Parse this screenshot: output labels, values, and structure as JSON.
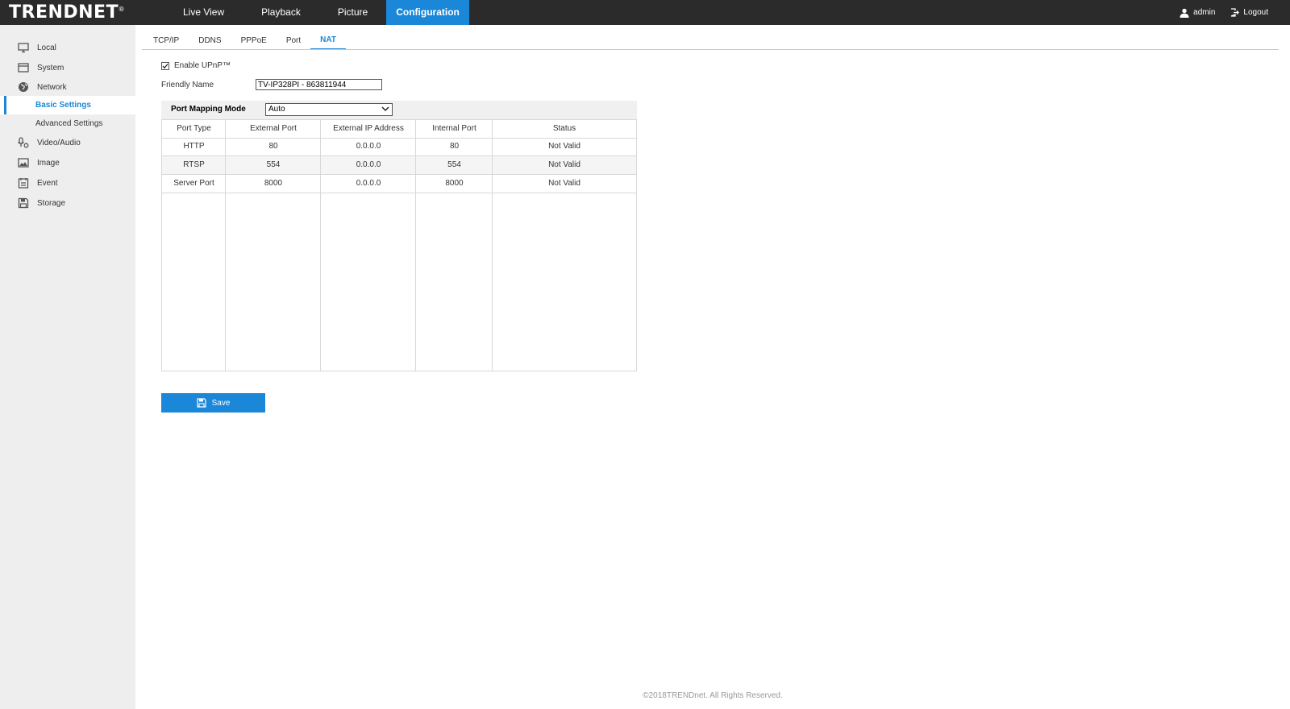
{
  "brand": {
    "logo_text": "TRENDNET",
    "registered_mark": "®"
  },
  "nav": {
    "items": [
      {
        "label": "Live View"
      },
      {
        "label": "Playback"
      },
      {
        "label": "Picture"
      },
      {
        "label": "Configuration"
      }
    ],
    "active": "Configuration"
  },
  "user": {
    "name": "admin",
    "logout_label": "Logout"
  },
  "sidebar": {
    "local": "Local",
    "system": "System",
    "network": "Network",
    "basic_settings": "Basic Settings",
    "advanced_settings": "Advanced Settings",
    "video_audio": "Video/Audio",
    "image": "Image",
    "event": "Event",
    "storage": "Storage",
    "active": "Basic Settings"
  },
  "tabs": {
    "items": [
      {
        "label": "TCP/IP"
      },
      {
        "label": "DDNS"
      },
      {
        "label": "PPPoE"
      },
      {
        "label": "Port"
      },
      {
        "label": "NAT"
      }
    ],
    "active": "NAT"
  },
  "form": {
    "enable_upnp_label": "Enable UPnP™",
    "enable_upnp_checked": true,
    "friendly_name_label": "Friendly Name",
    "friendly_name_value": "TV-IP328PI - 863811944",
    "port_mapping_mode_label": "Port Mapping Mode",
    "port_mapping_mode_value": "Auto"
  },
  "table": {
    "headers": [
      "Port Type",
      "External Port",
      "External IP Address",
      "Internal Port",
      "Status"
    ],
    "rows": [
      [
        "HTTP",
        "80",
        "0.0.0.0",
        "80",
        "Not Valid"
      ],
      [
        "RTSP",
        "554",
        "0.0.0.0",
        "554",
        "Not Valid"
      ],
      [
        "Server Port",
        "8000",
        "0.0.0.0",
        "8000",
        "Not Valid"
      ]
    ]
  },
  "save_label": "Save",
  "footer": "©2018TRENDnet. All Rights Reserved.",
  "colors": {
    "accent": "#1b87d8",
    "topbar": "#2b2b2b",
    "sidebar": "#eeeeee"
  }
}
